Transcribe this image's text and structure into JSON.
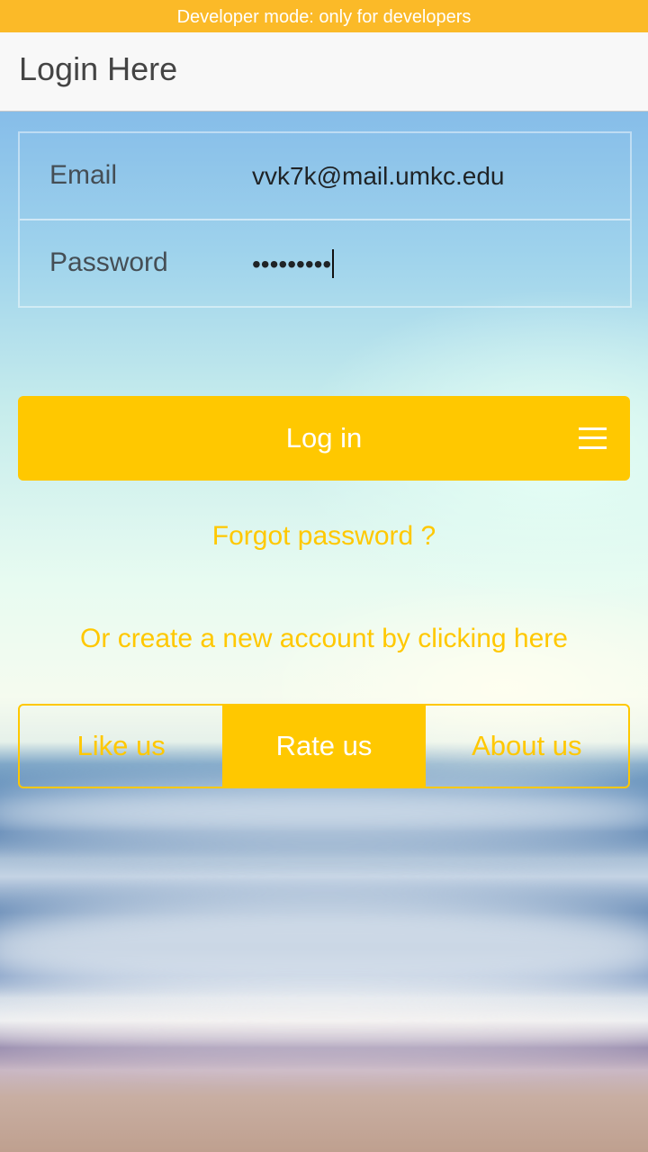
{
  "status_banner": "Developer mode: only for developers",
  "header": {
    "title": "Login Here"
  },
  "form": {
    "email_label": "Email",
    "email_value": "vvk7k@mail.umkc.edu",
    "password_label": "Password",
    "password_value": "•••••••••"
  },
  "login_button": {
    "label": "Log in",
    "icon": "menu-icon"
  },
  "links": {
    "forgot": "Forgot password ?",
    "create": "Or create a new account by clicking here"
  },
  "segments": [
    "Like us",
    "Rate us",
    "About us"
  ],
  "selected_segment": "Rate us",
  "colors": {
    "accent": "#ffc800",
    "banner": "#fbba28",
    "header_bg": "#f8f8f8"
  }
}
